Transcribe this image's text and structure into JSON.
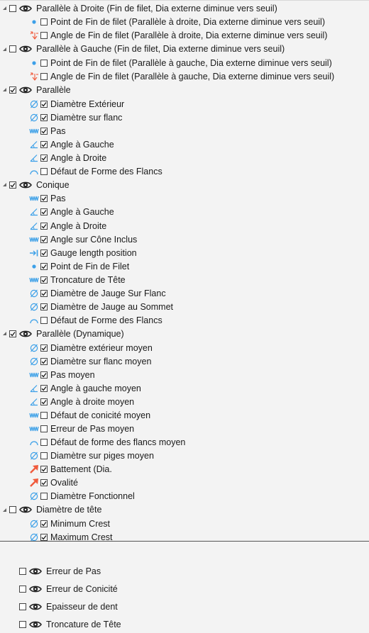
{
  "colors": {
    "blue_icon": "#3ca0e8",
    "orange_icon": "#f05a3c",
    "eye": "#222222",
    "separator": "#555555"
  },
  "tree": [
    {
      "type": "group",
      "label": "Parallèle à Droite (Fin de filet, Dia externe diminue vers seuil)",
      "checked": false,
      "expanded": true
    },
    {
      "type": "child",
      "icon": "dot-icon",
      "label": "Point de Fin de filet (Parallèle à droite, Dia externe diminue vers seuil)",
      "checked": false
    },
    {
      "type": "child",
      "icon": "runout-angle-icon",
      "label": "Angle de Fin de filet (Parallèle à droite, Dia externe diminue vers seuil)",
      "checked": false
    },
    {
      "type": "group",
      "label": "Parallèle à Gauche (Fin de filet, Dia externe diminue vers seuil)",
      "checked": false,
      "expanded": true
    },
    {
      "type": "child",
      "icon": "dot-icon",
      "label": "Point de Fin de filet (Parallèle à gauche, Dia externe diminue vers seuil)",
      "checked": false
    },
    {
      "type": "child",
      "icon": "runout-angle-icon",
      "label": "Angle de Fin de filet (Parallèle à gauche, Dia externe diminue vers seuil)",
      "checked": false
    },
    {
      "type": "group",
      "label": "Parallèle",
      "checked": true,
      "expanded": true
    },
    {
      "type": "child",
      "icon": "diameter-icon",
      "label": "Diamètre Extérieur",
      "checked": true
    },
    {
      "type": "child",
      "icon": "diameter-icon",
      "label": "Diamètre sur flanc",
      "checked": true
    },
    {
      "type": "child",
      "icon": "pitch-icon",
      "label": "Pas",
      "checked": true
    },
    {
      "type": "child",
      "icon": "angle-icon",
      "label": "Angle à Gauche",
      "checked": true
    },
    {
      "type": "child",
      "icon": "angle-icon",
      "label": "Angle à Droite",
      "checked": true
    },
    {
      "type": "child",
      "icon": "arc-icon",
      "label": " Défaut de Forme des Flancs",
      "checked": false
    },
    {
      "type": "group",
      "label": "Conique",
      "checked": true,
      "expanded": true
    },
    {
      "type": "child",
      "icon": "pitch-icon",
      "label": "Pas",
      "checked": true
    },
    {
      "type": "child",
      "icon": "angle-icon",
      "label": "Angle à Gauche",
      "checked": true
    },
    {
      "type": "child",
      "icon": "angle-icon",
      "label": "Angle à Droite",
      "checked": true
    },
    {
      "type": "child",
      "icon": "pitch-icon",
      "label": "Angle sur Cône Inclus",
      "checked": true
    },
    {
      "type": "child",
      "icon": "gauge-length-icon",
      "label": "Gauge length position",
      "checked": true
    },
    {
      "type": "child",
      "icon": "dot-icon",
      "label": "Point de Fin de Filet",
      "checked": true
    },
    {
      "type": "child",
      "icon": "pitch-icon",
      "label": "Troncature de Tête",
      "checked": true
    },
    {
      "type": "child",
      "icon": "diameter-icon",
      "label": "Diamètre de Jauge Sur Flanc",
      "checked": true
    },
    {
      "type": "child",
      "icon": "diameter-icon",
      "label": "Diamètre de Jauge au Sommet",
      "checked": true
    },
    {
      "type": "child",
      "icon": "arc-icon",
      "label": "Défaut de Forme des Flancs",
      "checked": false
    },
    {
      "type": "group",
      "label": "Parallèle (Dynamique)",
      "checked": true,
      "expanded": true
    },
    {
      "type": "child",
      "icon": "diameter-icon",
      "label": "Diamètre extérieur moyen",
      "checked": true
    },
    {
      "type": "child",
      "icon": "diameter-icon",
      "label": "Diamètre sur flanc moyen",
      "checked": true
    },
    {
      "type": "child",
      "icon": "pitch-icon",
      "label": "Pas moyen",
      "checked": true
    },
    {
      "type": "child",
      "icon": "angle-icon",
      "label": "Angle à gauche moyen",
      "checked": true
    },
    {
      "type": "child",
      "icon": "angle-icon",
      "label": "Angle à droite moyen",
      "checked": true
    },
    {
      "type": "child",
      "icon": "pitch-icon",
      "label": "Défaut de conicité moyen",
      "checked": false
    },
    {
      "type": "child",
      "icon": "pitch-icon",
      "label": "Erreur de Pas moyen",
      "checked": false
    },
    {
      "type": "child",
      "icon": "arc-icon",
      "label": "Défaut de forme des flancs moyen",
      "checked": false
    },
    {
      "type": "child",
      "icon": "diameter-icon",
      "label": "Diamètre sur piges moyen",
      "checked": false
    },
    {
      "type": "child",
      "icon": "runout-arrow-icon",
      "label": "Battement (Dia.",
      "checked": true
    },
    {
      "type": "child",
      "icon": "runout-arrow-icon",
      "label": "Ovalité",
      "checked": true
    },
    {
      "type": "child",
      "icon": "diameter-icon",
      "label": "Diamètre Fonctionnel",
      "checked": false
    },
    {
      "type": "group",
      "label": "Diamètre de tête",
      "checked": false,
      "expanded": true
    },
    {
      "type": "child",
      "icon": "diameter-icon",
      "label": "Minimum Crest",
      "checked": true
    },
    {
      "type": "child",
      "icon": "diameter-icon",
      "label": "Maximum Crest",
      "checked": true
    },
    {
      "type": "leaf",
      "label": "Erreur de Pas",
      "checked": false
    },
    {
      "type": "leaf",
      "label": "Erreur de Conicité",
      "checked": false
    },
    {
      "type": "leaf",
      "label": "Epaisseur de dent",
      "checked": false
    },
    {
      "type": "leaf",
      "label": "Troncature de Tête",
      "checked": false
    }
  ]
}
